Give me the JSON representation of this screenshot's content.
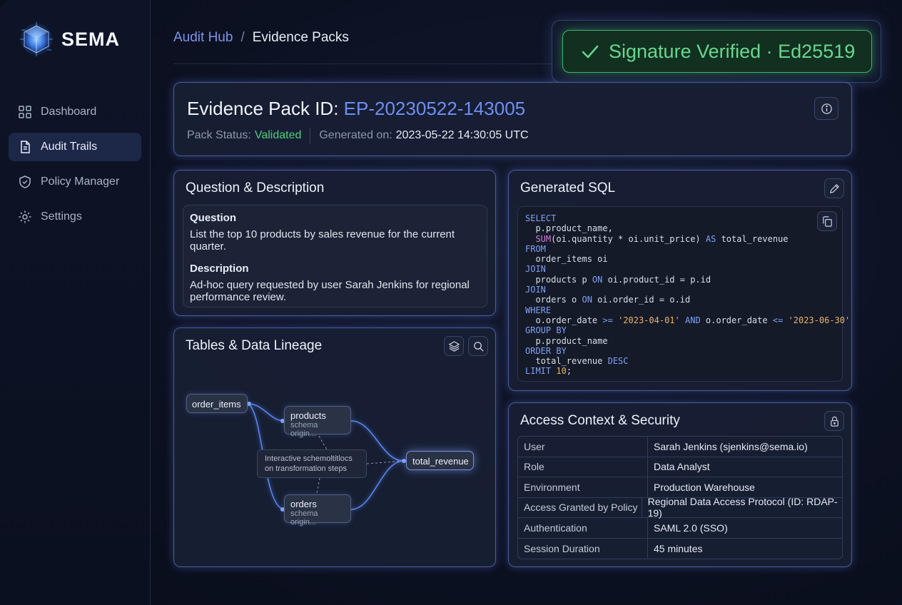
{
  "brand": {
    "name": "SEMA"
  },
  "sidebar": {
    "items": [
      {
        "label": "Dashboard",
        "icon": "grid-icon",
        "active": false
      },
      {
        "label": "Audit Trails",
        "icon": "document-icon",
        "active": true
      },
      {
        "label": "Policy Manager",
        "icon": "shield-icon",
        "active": false
      },
      {
        "label": "Settings",
        "icon": "gear-icon",
        "active": false
      }
    ]
  },
  "breadcrumb": {
    "parent": "Audit Hub",
    "separator": "/",
    "current": "Evidence Packs"
  },
  "signature": {
    "text": "Signature Verified · Ed25519",
    "icon": "check-icon",
    "color": "#69d690"
  },
  "evidence": {
    "title_prefix": "Evidence Pack ID:",
    "id": "EP-20230522-143005",
    "status_label": "Pack Status:",
    "status_value": "Validated",
    "generated_label": "Generated on:",
    "generated_value": "2023-05-22 14:30:05 UTC"
  },
  "question": {
    "title": "Question & Description",
    "question_label": "Question",
    "question_text": "List the top 10 products by sales revenue for the current quarter.",
    "description_label": "Description",
    "description_text": "Ad-hoc query requested by user Sarah Jenkins for regional performance review."
  },
  "sql": {
    "title": "Generated SQL",
    "lines": [
      [
        [
          "kw",
          "SELECT"
        ]
      ],
      [
        [
          "t",
          "  p.product_name,"
        ]
      ],
      [
        [
          "t",
          "  "
        ],
        [
          "fn",
          "SUM"
        ],
        [
          "t",
          "(oi.quantity * oi.unit_price) "
        ],
        [
          "kw",
          "AS"
        ],
        [
          "t",
          " total_revenue"
        ]
      ],
      [
        [
          "kw",
          "FROM"
        ]
      ],
      [
        [
          "t",
          "  order_items oi"
        ]
      ],
      [
        [
          "kw",
          "JOIN"
        ]
      ],
      [
        [
          "t",
          "  products p "
        ],
        [
          "kw",
          "ON"
        ],
        [
          "t",
          " oi.product_id = p.id"
        ]
      ],
      [
        [
          "kw",
          "JOIN"
        ]
      ],
      [
        [
          "t",
          "  orders o "
        ],
        [
          "kw",
          "ON"
        ],
        [
          "t",
          " oi.order_id = o.id"
        ]
      ],
      [
        [
          "kw",
          "WHERE"
        ]
      ],
      [
        [
          "t",
          "  o.order_date "
        ],
        [
          "kw",
          ">="
        ],
        [
          "t",
          " "
        ],
        [
          "str",
          "'2023-04-01'"
        ],
        [
          "t",
          " "
        ],
        [
          "kw",
          "AND"
        ],
        [
          "t",
          " o.order_date "
        ],
        [
          "kw",
          "<="
        ],
        [
          "t",
          " "
        ],
        [
          "str",
          "'2023-06-30'"
        ]
      ],
      [
        [
          "kw",
          "GROUP BY"
        ]
      ],
      [
        [
          "t",
          "  p.product_name"
        ]
      ],
      [
        [
          "kw",
          "ORDER BY"
        ]
      ],
      [
        [
          "t",
          "  total_revenue "
        ],
        [
          "kw",
          "DESC"
        ]
      ],
      [
        [
          "kw",
          "LIMIT"
        ],
        [
          "t",
          " "
        ],
        [
          "num",
          "10"
        ],
        [
          "t",
          ";"
        ]
      ]
    ]
  },
  "lineage": {
    "title": "Tables & Data Lineage",
    "nodes": {
      "order_items": "order_items",
      "products": "products",
      "products_sub": "schema origin...",
      "orders": "orders",
      "orders_sub": "schema origin...",
      "total_revenue": "total_revenue"
    },
    "tooltip_line1": "Interactive schemoltitlocs",
    "tooltip_line2": "on transformation steps"
  },
  "access": {
    "title": "Access Context & Security",
    "rows": [
      {
        "key": "User",
        "value": "Sarah Jenkins (sjenkins@sema.io)"
      },
      {
        "key": "Role",
        "value": "Data Analyst"
      },
      {
        "key": "Environment",
        "value": "Production Warehouse"
      },
      {
        "key": "Access Granted by Policy",
        "value": "Regional Data Access Protocol (ID: RDAP-19)"
      },
      {
        "key": "Authentication",
        "value": "SAML 2.0 (SSO)"
      },
      {
        "key": "Session Duration",
        "value": "45 minutes"
      }
    ]
  }
}
